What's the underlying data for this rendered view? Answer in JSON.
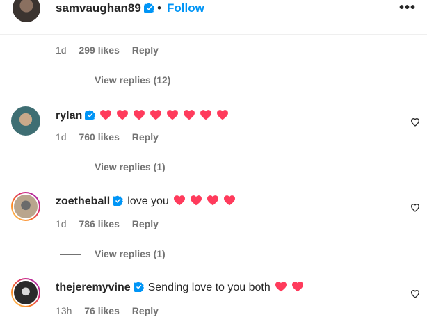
{
  "header": {
    "username": "samvaughan89",
    "separator": "•",
    "follow_label": "Follow",
    "more_label": "•••"
  },
  "first_comment_meta": {
    "age": "1d",
    "likes": "299 likes",
    "reply": "Reply"
  },
  "first_view_replies": "View replies (12)",
  "comments": [
    {
      "username": "rylan",
      "text": "",
      "hearts": 8,
      "age": "1d",
      "likes": "760 likes",
      "reply": "Reply",
      "view_replies": "View replies (1)"
    },
    {
      "username": "zoetheball",
      "text": "love you",
      "hearts": 4,
      "age": "1d",
      "likes": "786 likes",
      "reply": "Reply",
      "view_replies": "View replies (1)"
    },
    {
      "username": "thejeremyvine",
      "text": "Sending love to you both",
      "hearts": 2,
      "age": "13h",
      "likes": "76 likes",
      "reply": "Reply"
    }
  ],
  "colors": {
    "accent": "#0095f6",
    "heart": "#ff3b5c",
    "verified": "#0095f6",
    "meta": "#737373"
  }
}
